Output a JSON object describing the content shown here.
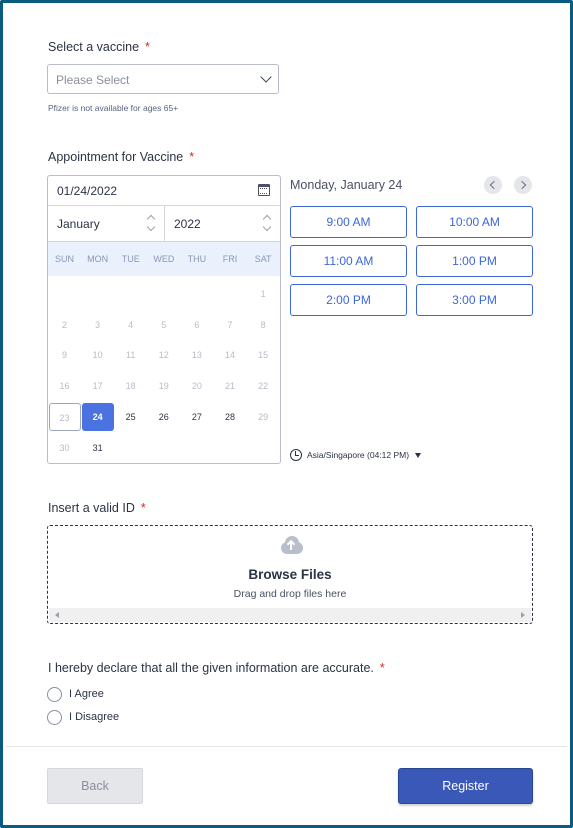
{
  "vaccine": {
    "label": "Select a vaccine",
    "required_mark": "*",
    "placeholder": "Please Select",
    "note": "Pfizer is not available for ages 65+"
  },
  "appointment": {
    "label": "Appointment for Vaccine",
    "required_mark": "*",
    "date_value": "01/24/2022",
    "month": "January",
    "year": "2022",
    "weekdays": [
      "SUN",
      "MON",
      "TUE",
      "WED",
      "THU",
      "FRI",
      "SAT"
    ],
    "days": [
      {
        "n": "1",
        "state": "disabled"
      },
      {
        "n": "2",
        "state": "disabled"
      },
      {
        "n": "3",
        "state": "disabled"
      },
      {
        "n": "4",
        "state": "disabled"
      },
      {
        "n": "5",
        "state": "disabled"
      },
      {
        "n": "6",
        "state": "disabled"
      },
      {
        "n": "7",
        "state": "disabled"
      },
      {
        "n": "8",
        "state": "disabled"
      },
      {
        "n": "9",
        "state": "disabled"
      },
      {
        "n": "10",
        "state": "disabled"
      },
      {
        "n": "11",
        "state": "disabled"
      },
      {
        "n": "12",
        "state": "disabled"
      },
      {
        "n": "13",
        "state": "disabled"
      },
      {
        "n": "14",
        "state": "disabled"
      },
      {
        "n": "15",
        "state": "disabled"
      },
      {
        "n": "16",
        "state": "disabled"
      },
      {
        "n": "17",
        "state": "disabled"
      },
      {
        "n": "18",
        "state": "disabled"
      },
      {
        "n": "19",
        "state": "disabled"
      },
      {
        "n": "20",
        "state": "disabled"
      },
      {
        "n": "21",
        "state": "disabled"
      },
      {
        "n": "22",
        "state": "disabled"
      },
      {
        "n": "23",
        "state": "today"
      },
      {
        "n": "24",
        "state": "selected"
      },
      {
        "n": "25",
        "state": "active"
      },
      {
        "n": "26",
        "state": "active"
      },
      {
        "n": "27",
        "state": "active"
      },
      {
        "n": "28",
        "state": "active"
      },
      {
        "n": "29",
        "state": "disabled"
      },
      {
        "n": "30",
        "state": "disabled"
      },
      {
        "n": "31",
        "state": "active"
      }
    ],
    "selected_day_title": "Monday, January 24",
    "time_slots": [
      "9:00 AM",
      "10:00 AM",
      "11:00 AM",
      "1:00 PM",
      "2:00 PM",
      "3:00 PM"
    ],
    "timezone": "Asia/Singapore (04:12 PM)"
  },
  "id_upload": {
    "label": "Insert a valid ID",
    "required_mark": "*",
    "browse": "Browse Files",
    "hint": "Drag and drop files here"
  },
  "declaration": {
    "label": "I hereby declare that all the given information are accurate.",
    "required_mark": "*",
    "options": [
      "I Agree",
      "I Disagree"
    ]
  },
  "buttons": {
    "back": "Back",
    "register": "Register"
  }
}
